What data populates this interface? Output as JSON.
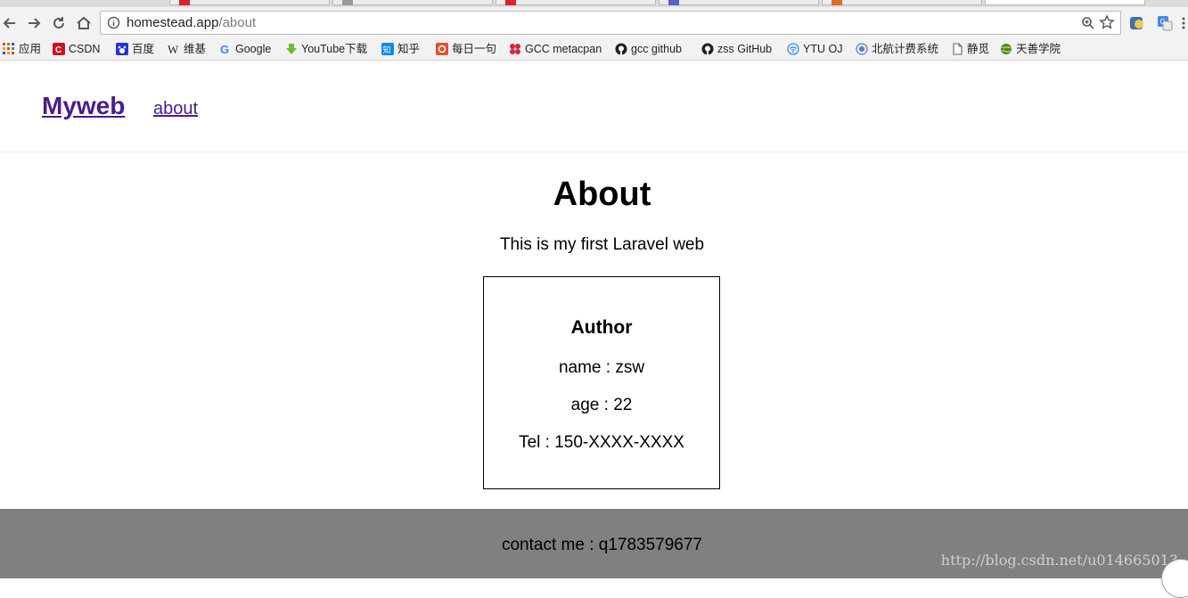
{
  "browser": {
    "url_host": "homestead.app",
    "url_path": "/about",
    "bookmarks": [
      {
        "label": "应用",
        "icon": "apps-grid-icon"
      },
      {
        "label": "CSDN",
        "icon": "csdn-icon"
      },
      {
        "label": "百度",
        "icon": "baidu-paw-icon"
      },
      {
        "label": "维基",
        "icon": "wikipedia-icon"
      },
      {
        "label": "Google",
        "icon": "google-icon"
      },
      {
        "label": "YouTube下载",
        "icon": "download-arrow-icon"
      },
      {
        "label": "知乎",
        "icon": "zhihu-icon"
      },
      {
        "label": "每日一句",
        "icon": "daily-quote-icon"
      },
      {
        "label": "GCC metacpan",
        "icon": "metacpan-icon"
      },
      {
        "label": "gcc github",
        "icon": "github-icon"
      },
      {
        "label": "zss GitHub",
        "icon": "github-icon"
      },
      {
        "label": "YTU OJ",
        "icon": "wifi-icon"
      },
      {
        "label": "北航计费系统",
        "icon": "university-seal-icon"
      },
      {
        "label": "静觅",
        "icon": "page-icon"
      },
      {
        "label": "天善学院",
        "icon": "globe-icon"
      }
    ]
  },
  "site": {
    "brand": "Myweb",
    "nav_about": "about"
  },
  "main": {
    "heading": "About",
    "subtitle": "This is my first Laravel web",
    "card": {
      "title": "Author",
      "name": "name : zsw",
      "age": "age : 22",
      "tel": "Tel : 150-XXXX-XXXX"
    }
  },
  "footer": {
    "contact": "contact me : q1783579677",
    "watermark": "http://blog.csdn.net/u014665013"
  },
  "colors": {
    "link": "#4b1c8c",
    "footer_bg": "#808080"
  }
}
